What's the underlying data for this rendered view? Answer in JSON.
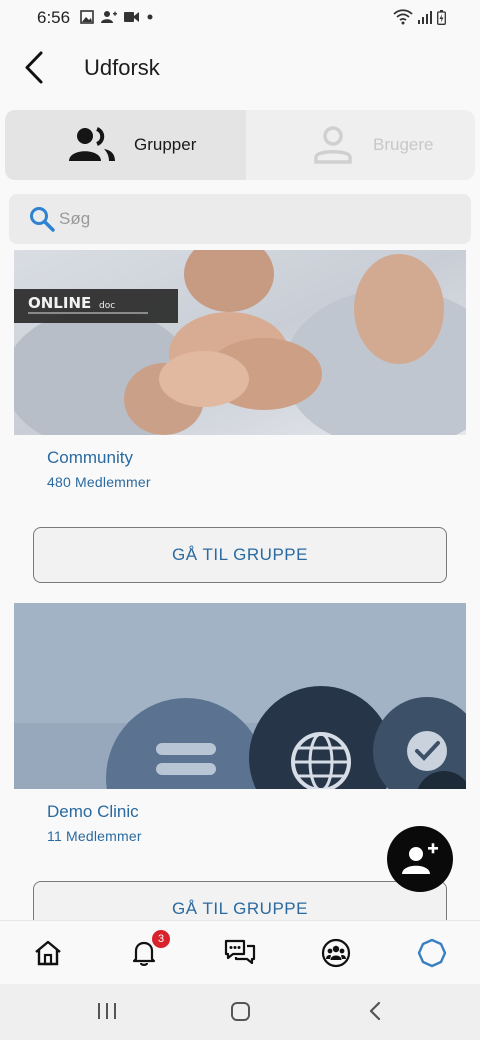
{
  "status_bar": {
    "time": "6:56"
  },
  "app_bar": {
    "title": "Udforsk"
  },
  "tabs": [
    {
      "label": "Grupper",
      "active": true,
      "icon": "groups-icon"
    },
    {
      "label": "Brugere",
      "active": false,
      "icon": "person-icon"
    }
  ],
  "search": {
    "placeholder": "Søg"
  },
  "groups": [
    {
      "name": "Community",
      "members": "480 Medlemmer",
      "button": "GÅ TIL GRUPPE",
      "logo_text": "ONLINE"
    },
    {
      "name": "Demo Clinic",
      "members": "11 Medlemmer",
      "button": "GÅ TIL GRUPPE"
    }
  ],
  "bottom_nav": {
    "items": [
      "home-icon",
      "bell-icon",
      "chat-icon",
      "groups-icon",
      "explore-icon"
    ],
    "notification_count": "3",
    "active": "explore-icon"
  },
  "colors": {
    "accent": "#2a6aa0",
    "fab": "#0a0a0a",
    "badge": "#d9232c",
    "active_nav": "#3a7fc0"
  }
}
